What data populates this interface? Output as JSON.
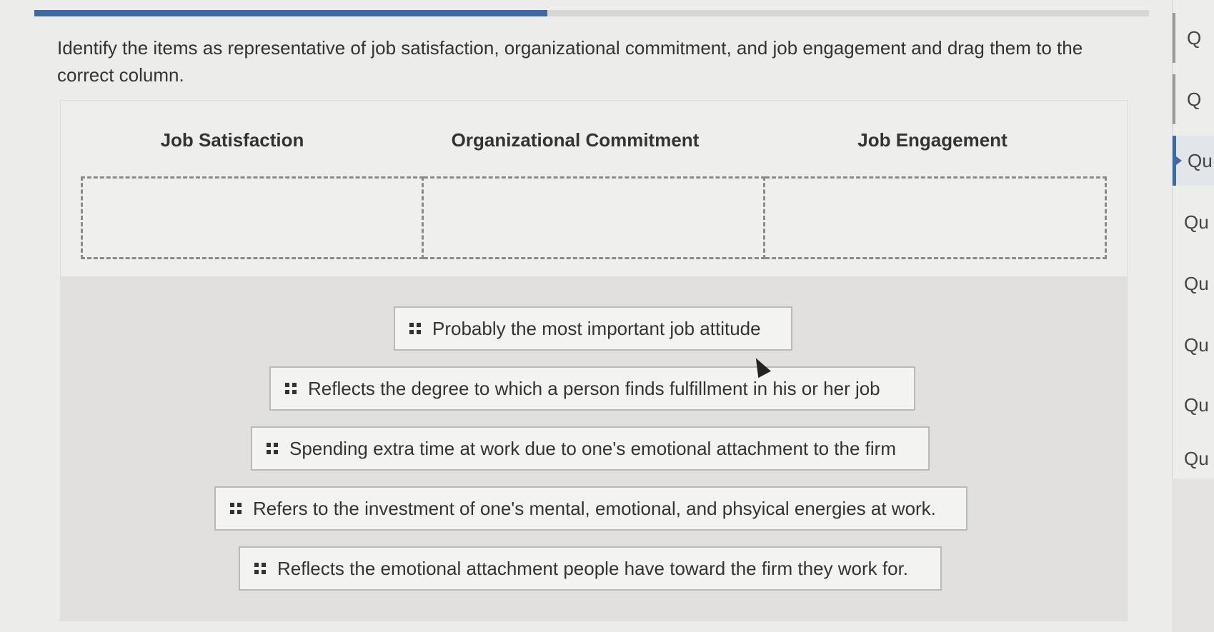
{
  "progress": {
    "fraction": 0.46
  },
  "prompt": "Identify the items as representative of job satisfaction, organizational commitment, and job engagement and drag them to the correct column.",
  "columns": [
    {
      "label": "Job Satisfaction"
    },
    {
      "label": "Organizational Commitment"
    },
    {
      "label": "Job Engagement"
    }
  ],
  "items": [
    {
      "text": "Probably the most important job attitude",
      "grip_icon": "drag-handle-icon"
    },
    {
      "text": "Reflects the degree to which a person finds fulfillment in his or her job",
      "grip_icon": "drag-handle-icon"
    },
    {
      "text": "Spending extra time at work due to one's emotional attachment to the firm",
      "grip_icon": "drag-handle-icon"
    },
    {
      "text": "Refers to the investment of one's mental, emotional, and phsyical energies at work.",
      "grip_icon": "drag-handle-icon"
    },
    {
      "text": "Reflects the emotional attachment people have toward the firm they work for.",
      "grip_icon": "drag-handle-icon"
    }
  ],
  "question_nav": [
    {
      "label": "Q",
      "state": "done"
    },
    {
      "label": "Q",
      "state": "done"
    },
    {
      "label": "Qu",
      "state": "active"
    },
    {
      "label": "Qu",
      "state": "pending"
    },
    {
      "label": "Qu",
      "state": "pending"
    },
    {
      "label": "Qu",
      "state": "pending"
    },
    {
      "label": "Qu",
      "state": "pending"
    },
    {
      "label": "Qu",
      "state": "pending"
    }
  ],
  "colors": {
    "accent": "#3d6aa2",
    "dashed_border": "#8a8a8a"
  }
}
